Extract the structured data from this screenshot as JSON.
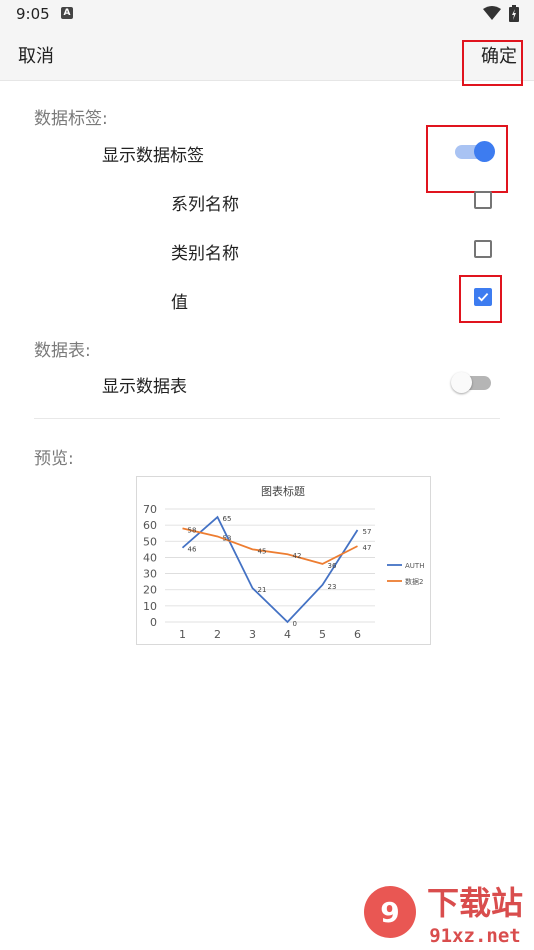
{
  "status_bar": {
    "time": "9:05",
    "notification_letter": "A"
  },
  "app_bar": {
    "cancel_label": "取消",
    "confirm_label": "确定"
  },
  "data_labels": {
    "section_title": "数据标签:",
    "show_label": "显示数据标签",
    "show_enabled": true,
    "options": [
      {
        "label": "系列名称",
        "checked": false
      },
      {
        "label": "类别名称",
        "checked": false
      },
      {
        "label": "值",
        "checked": true
      }
    ]
  },
  "data_table": {
    "section_title": "数据表:",
    "show_label": "显示数据表",
    "show_enabled": false
  },
  "preview": {
    "section_title": "预览:"
  },
  "chart_data": {
    "type": "line",
    "title": "图表标题",
    "categories": [
      "1",
      "2",
      "3",
      "4",
      "5",
      "6"
    ],
    "series": [
      {
        "name": "AUTH",
        "values": [
          46,
          65,
          21,
          0,
          23,
          57
        ],
        "color": "#4472c4"
      },
      {
        "name": "数据2",
        "values": [
          58,
          53,
          45,
          42,
          36,
          47
        ],
        "color": "#ed7d31"
      }
    ],
    "ylim": [
      0,
      70
    ],
    "yticks": [
      0,
      10,
      20,
      30,
      40,
      50,
      60,
      70
    ],
    "grid": true,
    "data_labels": true,
    "legend": "right"
  },
  "watermark": {
    "text": "下载站",
    "domain": "91xz.net"
  },
  "colors": {
    "accent": "#3d7cf0",
    "highlight": "#e0141e"
  }
}
